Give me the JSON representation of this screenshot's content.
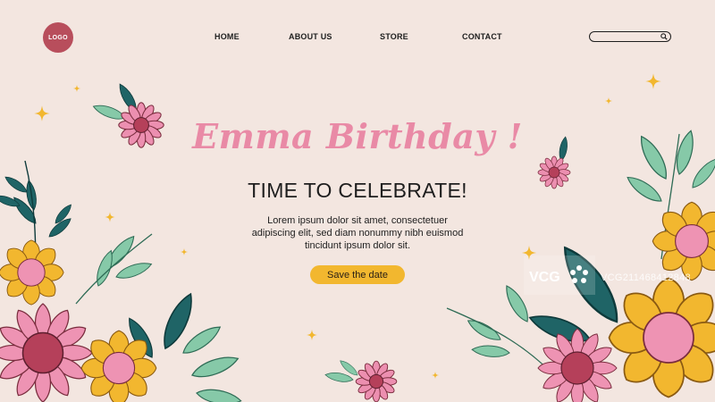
{
  "header": {
    "logo_label": "LOGO",
    "nav": [
      {
        "label": "HOME"
      },
      {
        "label": "ABOUT US"
      },
      {
        "label": "STORE"
      },
      {
        "label": "CONTACT"
      }
    ],
    "search": {
      "value": "",
      "placeholder": ""
    }
  },
  "hero": {
    "headline": "Emma Birthday !",
    "subheadline": "TIME TO CELEBRATE!",
    "body_lines": [
      "Lorem ipsum dolor sit amet, consectetuer",
      "adipiscing elit, sed diam nonummy nibh euismod",
      "tincidunt ipsum dolor sit."
    ],
    "cta_label": "Save the date"
  },
  "watermark": {
    "brand": "VCG",
    "id_text": "VCG211468412848"
  },
  "colors": {
    "background": "#f3e6e0",
    "logo": "#b84e5c",
    "headline_pink": "#e98aa6",
    "cta_yellow": "#f2b72f",
    "leaf_dark_teal": "#1f6466",
    "leaf_mint": "#86c9a8",
    "flower_pink": "#ec8fb0",
    "flower_yellow": "#f2b72f"
  },
  "icons": [
    "search-icon",
    "sparkle-icon",
    "flower-icon",
    "leaf-icon"
  ]
}
